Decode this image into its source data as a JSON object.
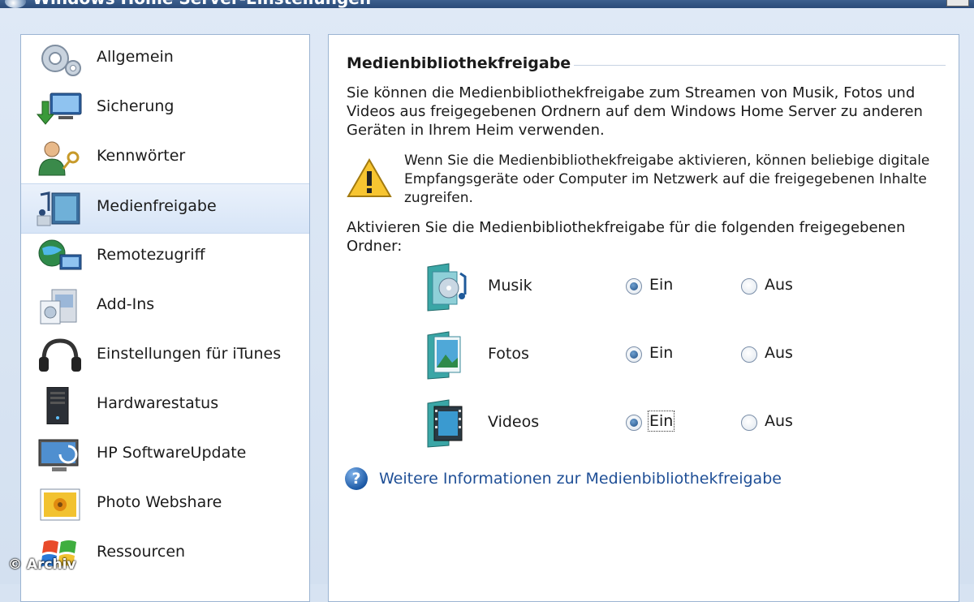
{
  "window": {
    "title": "Windows Home Server-Einstellungen"
  },
  "sidebar": {
    "items": [
      {
        "label": "Allgemein",
        "icon": "gears-icon"
      },
      {
        "label": "Sicherung",
        "icon": "backup-icon"
      },
      {
        "label": "Kennwörter",
        "icon": "user-key-icon"
      },
      {
        "label": "Medienfreigabe",
        "icon": "media-sharing-icon",
        "selected": true
      },
      {
        "label": "Remotezugriff",
        "icon": "globe-computer-icon"
      },
      {
        "label": "Add-Ins",
        "icon": "addins-icon"
      },
      {
        "label": "Einstellungen für iTunes",
        "icon": "headphones-icon"
      },
      {
        "label": "Hardwarestatus",
        "icon": "server-tower-icon"
      },
      {
        "label": "HP SoftwareUpdate",
        "icon": "monitor-update-icon"
      },
      {
        "label": "Photo Webshare",
        "icon": "photo-icon"
      },
      {
        "label": "Ressourcen",
        "icon": "windows-logo-icon"
      }
    ]
  },
  "main": {
    "title": "Medienbibliothekfreigabe",
    "description": "Sie können die Medienbibliothekfreigabe zum Streamen von Musik, Fotos und Videos aus freigegebenen Ordnern auf dem Windows Home Server zu anderen Geräten in Ihrem Heim verwenden.",
    "warning": "Wenn Sie die Medienbibliothekfreigabe aktivieren, können beliebige digitale Empfangsgeräte oder Computer im Netzwerk auf die freigegebenen Inhalte zugreifen.",
    "folders_label": "Aktivieren Sie die Medienbibliothekfreigabe für die folgenden freigegebenen Ordner:",
    "option_on": "Ein",
    "option_off": "Aus",
    "folders": [
      {
        "name": "Musik",
        "selected": "Ein",
        "icon": "music-folder-icon"
      },
      {
        "name": "Fotos",
        "selected": "Ein",
        "icon": "photos-folder-icon"
      },
      {
        "name": "Videos",
        "selected": "Ein",
        "icon": "videos-folder-icon"
      }
    ],
    "help_link": "Weitere Informationen zur Medienbibliothekfreigabe"
  },
  "watermark": "© Archiv"
}
